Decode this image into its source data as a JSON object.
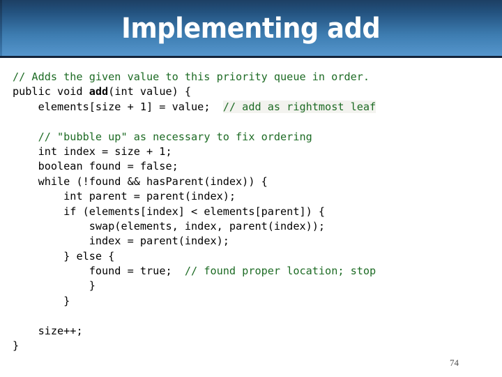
{
  "slide": {
    "title": "Implementing add",
    "page_number": "74",
    "accent_color_dark": "#1d3f63",
    "accent_color_light": "#5596cd",
    "comment_color": "#1d6b24",
    "code_color": "#000000"
  },
  "code": {
    "language": "java",
    "lines": [
      {
        "indent": 0,
        "tokens": [
          {
            "text": "// Adds the given value to this priority queue in order.",
            "type": "comment"
          }
        ]
      },
      {
        "indent": 0,
        "tokens": [
          {
            "text": "public void ",
            "type": "code"
          },
          {
            "text": "add",
            "type": "bold"
          },
          {
            "text": "(int value) {",
            "type": "code"
          }
        ]
      },
      {
        "indent": 1,
        "tokens": [
          {
            "text": "elements[size + 1] = value;  ",
            "type": "code"
          },
          {
            "text": "// add as rightmost leaf",
            "type": "comment-highlight"
          }
        ]
      },
      {
        "indent": 0,
        "tokens": []
      },
      {
        "indent": 1,
        "tokens": [
          {
            "text": "// \"bubble up\" as necessary to fix ordering",
            "type": "comment"
          }
        ]
      },
      {
        "indent": 1,
        "tokens": [
          {
            "text": "int index = size + 1;",
            "type": "code"
          }
        ]
      },
      {
        "indent": 1,
        "tokens": [
          {
            "text": "boolean found = false;",
            "type": "code"
          }
        ]
      },
      {
        "indent": 1,
        "tokens": [
          {
            "text": "while (!found && hasParent(index)) {",
            "type": "code"
          }
        ]
      },
      {
        "indent": 2,
        "tokens": [
          {
            "text": "int parent = parent(index);",
            "type": "code"
          }
        ]
      },
      {
        "indent": 2,
        "tokens": [
          {
            "text": "if (elements[index] < elements[parent]) {",
            "type": "code"
          }
        ]
      },
      {
        "indent": 3,
        "tokens": [
          {
            "text": "swap(elements, index, parent(index));",
            "type": "code"
          }
        ]
      },
      {
        "indent": 3,
        "tokens": [
          {
            "text": "index = parent(index);",
            "type": "code"
          }
        ]
      },
      {
        "indent": 2,
        "tokens": [
          {
            "text": "} else {",
            "type": "code"
          }
        ]
      },
      {
        "indent": 3,
        "tokens": [
          {
            "text": "found = true;  ",
            "type": "code"
          },
          {
            "text": "// found proper location; stop",
            "type": "comment"
          }
        ]
      },
      {
        "indent": 3,
        "tokens": [
          {
            "text": "}",
            "type": "code"
          }
        ]
      },
      {
        "indent": 2,
        "tokens": [
          {
            "text": "}",
            "type": "code"
          }
        ]
      },
      {
        "indent": 0,
        "tokens": []
      },
      {
        "indent": 1,
        "tokens": [
          {
            "text": "size++;",
            "type": "code"
          }
        ]
      },
      {
        "indent": 0,
        "tokens": [
          {
            "text": "}",
            "type": "code"
          }
        ]
      }
    ]
  }
}
